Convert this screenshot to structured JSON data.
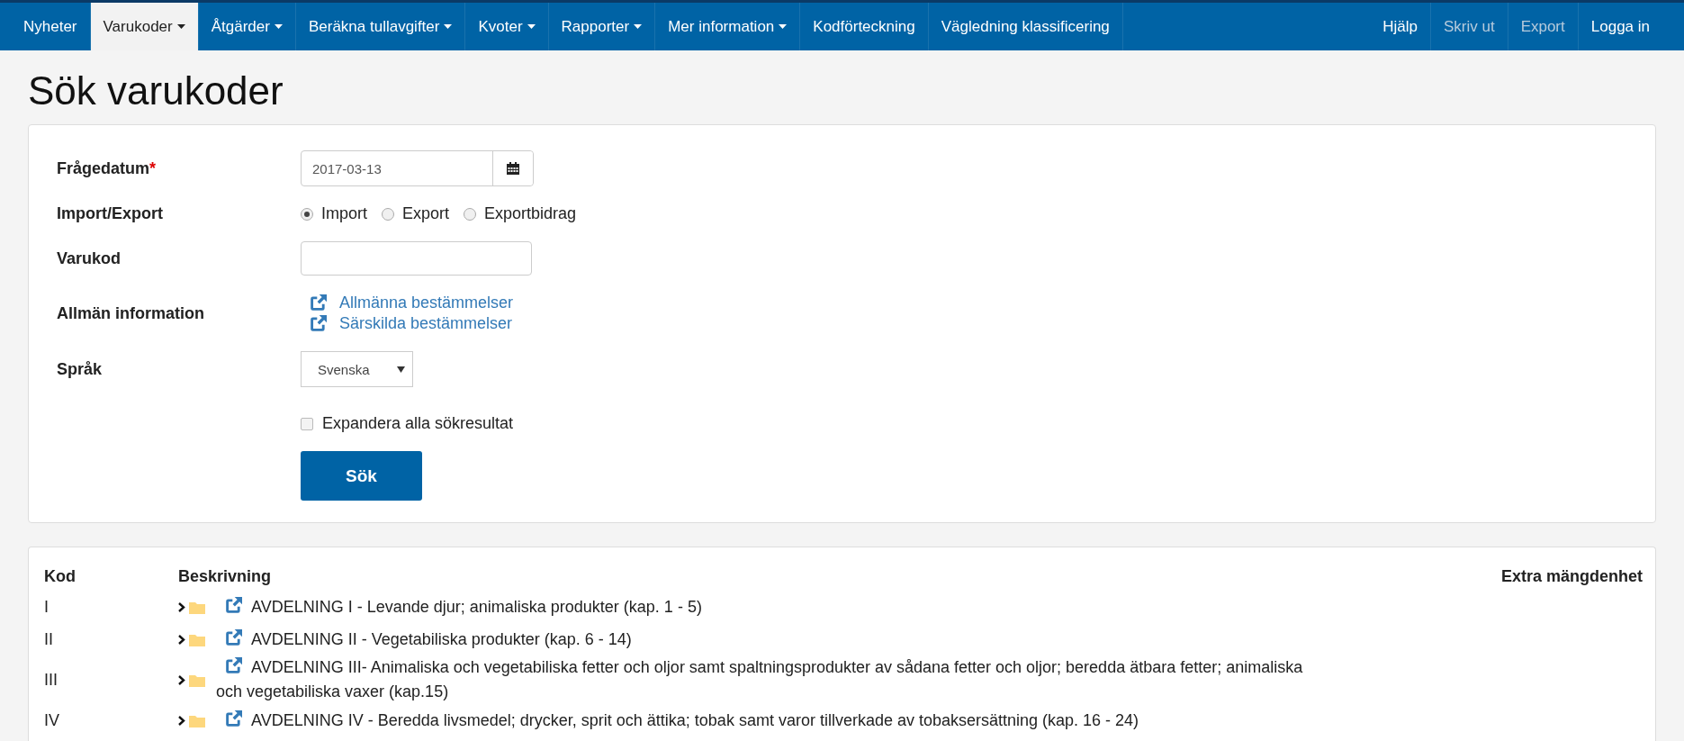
{
  "nav": {
    "left": [
      {
        "label": "Nyheter",
        "selected": false,
        "dropdown": false
      },
      {
        "label": "Varukoder",
        "selected": true,
        "dropdown": true
      },
      {
        "label": "Åtgärder",
        "selected": false,
        "dropdown": true
      },
      {
        "label": "Beräkna tullavgifter",
        "selected": false,
        "dropdown": true
      },
      {
        "label": "Kvoter",
        "selected": false,
        "dropdown": true
      },
      {
        "label": "Rapporter",
        "selected": false,
        "dropdown": true
      },
      {
        "label": "Mer information",
        "selected": false,
        "dropdown": true
      },
      {
        "label": "Kodförteckning",
        "selected": false,
        "dropdown": false
      },
      {
        "label": "Vägledning klassificering",
        "selected": false,
        "dropdown": false
      }
    ],
    "right": [
      {
        "label": "Hjälp",
        "disabled": false
      },
      {
        "label": "Skriv ut",
        "disabled": true
      },
      {
        "label": "Export",
        "disabled": true
      },
      {
        "label": "Logga in",
        "disabled": false
      }
    ]
  },
  "page_title": "Sök varukoder",
  "form": {
    "date": {
      "label": "Frågedatum",
      "required_mark": "*",
      "value": "2017-03-13"
    },
    "direction": {
      "label": "Import/Export",
      "options": [
        {
          "label": "Import",
          "selected": true
        },
        {
          "label": "Export",
          "selected": false
        },
        {
          "label": "Exportbidrag",
          "selected": false
        }
      ]
    },
    "code": {
      "label": "Varukod"
    },
    "info": {
      "label": "Allmän information",
      "links": [
        "Allmänna bestämmelser",
        "Särskilda bestämmelser"
      ]
    },
    "language": {
      "label": "Språk",
      "value": "Svenska"
    },
    "expand": {
      "label": "Expandera alla sökresultat",
      "checked": false
    },
    "submit": "Sök"
  },
  "results": {
    "columns": [
      "Kod",
      "Beskrivning",
      "Extra mängdenhet"
    ],
    "rows": [
      {
        "code": "I",
        "description": "AVDELNING I - Levande djur; animaliska produkter (kap. 1 - 5)"
      },
      {
        "code": "II",
        "description": "AVDELNING II - Vegetabiliska produkter (kap. 6 - 14)"
      },
      {
        "code": "III",
        "description": "AVDELNING III- Animaliska och vegetabiliska fetter och oljor samt spaltningsprodukter av sådana fetter och oljor; beredda ätbara fetter; animaliska och vegetabiliska vaxer (kap.15)"
      },
      {
        "code": "IV",
        "description": "AVDELNING IV - Beredda livsmedel; drycker, sprit och ättika; tobak samt varor tillverkade av tobaksersättning (kap. 16 - 24)"
      }
    ]
  }
}
